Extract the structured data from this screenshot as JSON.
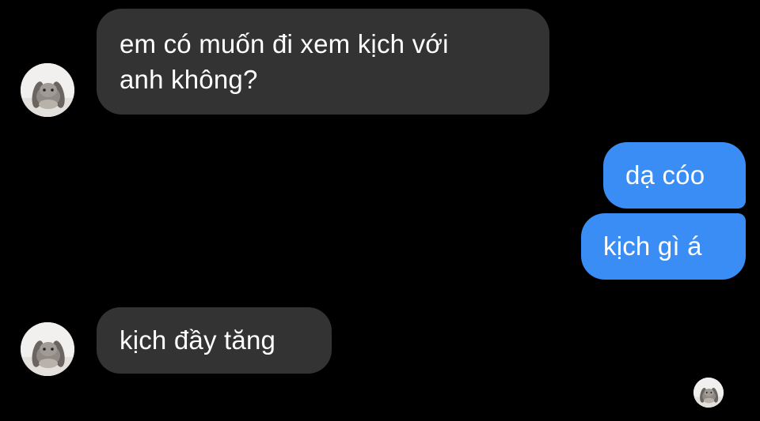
{
  "messages": [
    {
      "direction": "incoming",
      "lines": [
        "em có muốn đi xem kịch với",
        "anh không?"
      ]
    },
    {
      "direction": "outgoing",
      "text": "dạ cóo"
    },
    {
      "direction": "outgoing",
      "text": "kịch gì á"
    },
    {
      "direction": "incoming",
      "text": "kịch đầy tăng"
    }
  ],
  "avatars": {
    "contact_icon": "bunny-avatar-icon",
    "seen_icon": "seen-receipt-avatar-icon"
  },
  "colors": {
    "background": "#000000",
    "incoming_bubble": "#333333",
    "outgoing_bubble": "#3a8df5",
    "text": "#ffffff"
  }
}
